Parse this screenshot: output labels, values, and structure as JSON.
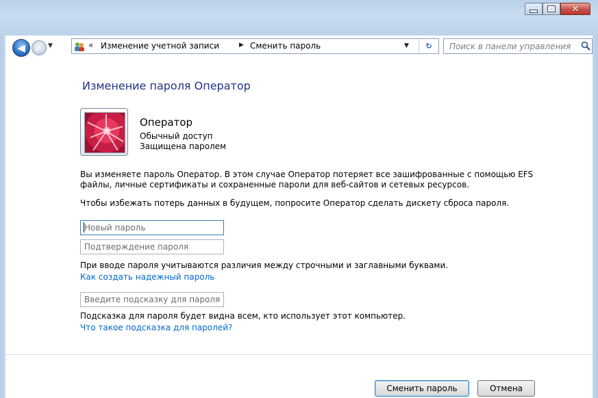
{
  "window": {
    "minimize_label": "",
    "maximize_label": "",
    "close_label": "✕"
  },
  "navigation": {
    "back_icon": "back-arrow-icon",
    "forward_icon": "forward-arrow-icon"
  },
  "address_bar": {
    "breadcrumb_overflow": "«",
    "crumbs": [
      "Изменение учетной записи",
      "Сменить пароль"
    ],
    "separator": "▶",
    "dropdown": "▼",
    "refresh": "↻"
  },
  "search": {
    "placeholder": "Поиск в панели управления"
  },
  "page": {
    "title": "Изменение пароля Оператор",
    "user": {
      "name": "Оператор",
      "access": "Обычный доступ",
      "protection": "Защищена паролем"
    },
    "description_line1": "Вы изменяете пароль Оператор. В этом случае Оператор потеряет все зашифрованные с помощью EFS",
    "description_line2": "файлы, личные сертификаты и сохраненные пароли для веб-сайтов и сетевых ресурсов.",
    "description_line3": "Чтобы избежать потерь данных в будущем, попросите Оператор сделать дискету сброса пароля.",
    "fields": {
      "new_password_placeholder": "Новый пароль",
      "new_password_value": "",
      "confirm_password_placeholder": "Подтверждение пароля",
      "confirm_password_value": "",
      "hint_placeholder": "Введите подсказку для пароля",
      "hint_value": ""
    },
    "case_note": "При вводе пароля учитываются различия между строчными и заглавными буквами.",
    "strong_password_link": "Как создать надежный пароль",
    "hint_note": "Подсказка для пароля будет видна всем, кто использует этот компьютер.",
    "hint_link": "Что такое подсказка для паролей?"
  },
  "buttons": {
    "change": "Сменить пароль",
    "cancel": "Отмена"
  },
  "colors": {
    "title": "#1e3287",
    "link": "#0066cc",
    "frame": "#b9d1ea"
  }
}
